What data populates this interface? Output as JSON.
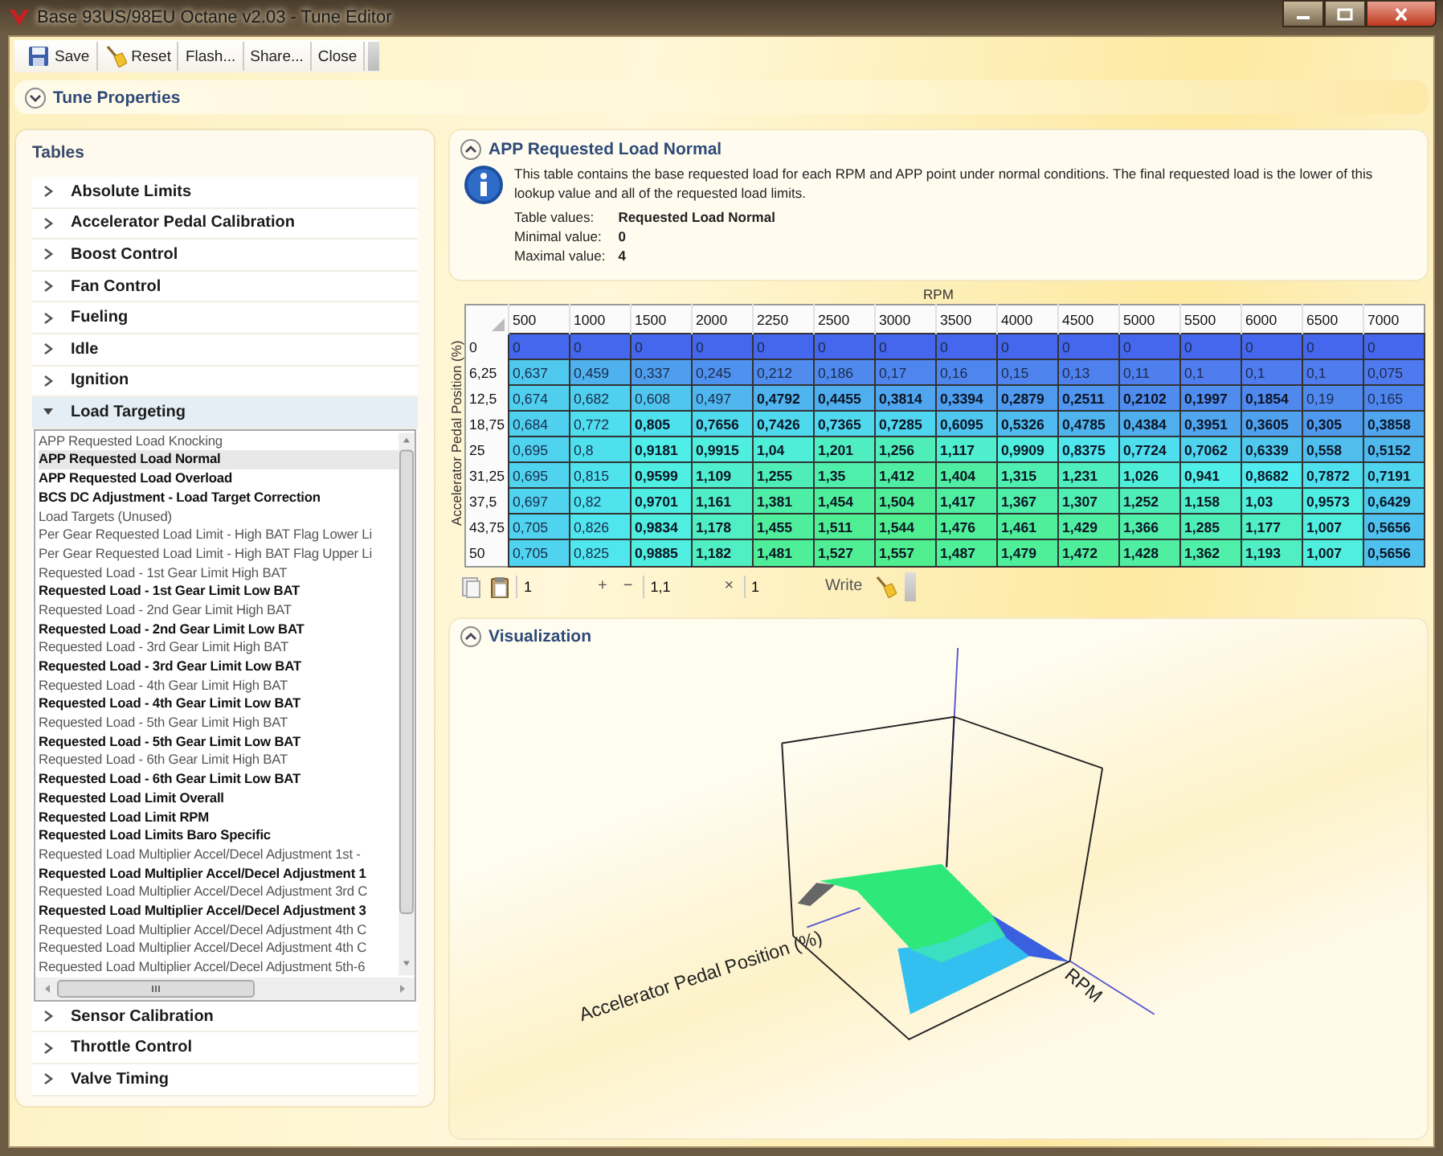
{
  "window": {
    "title": "Base 93US/98EU Octane v2.03 - Tune Editor"
  },
  "toolbar": [
    {
      "label": "Save"
    },
    {
      "label": "Reset"
    },
    {
      "label": "Flash..."
    },
    {
      "label": "Share..."
    },
    {
      "label": "Close"
    }
  ],
  "tune_properties": {
    "title": "Tune Properties",
    "expanded": false
  },
  "tables_panel": {
    "title": "Tables",
    "groups": [
      {
        "label": "Absolute Limits",
        "expanded": false
      },
      {
        "label": "Accelerator Pedal Calibration",
        "expanded": false
      },
      {
        "label": "Boost Control",
        "expanded": false
      },
      {
        "label": "Fan Control",
        "expanded": false
      },
      {
        "label": "Fueling",
        "expanded": false
      },
      {
        "label": "Idle",
        "expanded": false
      },
      {
        "label": "Ignition",
        "expanded": false
      },
      {
        "label": "Load Targeting",
        "expanded": true,
        "children": [
          {
            "label": "APP Requested Load Knocking",
            "bold": false,
            "selected": false
          },
          {
            "label": "APP Requested Load Normal",
            "bold": true,
            "selected": true
          },
          {
            "label": "APP Requested Load Overload",
            "bold": true,
            "selected": false
          },
          {
            "label": "BCS DC Adjustment - Load Target Correction",
            "bold": true,
            "selected": false
          },
          {
            "label": "Load Targets (Unused)",
            "bold": false,
            "selected": false
          },
          {
            "label": "Per Gear Requested Load Limit - High BAT Flag Lower Li",
            "bold": false,
            "selected": false
          },
          {
            "label": "Per Gear Requested Load Limit - High BAT Flag Upper Li",
            "bold": false,
            "selected": false
          },
          {
            "label": "Requested Load - 1st Gear Limit High BAT",
            "bold": false,
            "selected": false
          },
          {
            "label": "Requested Load - 1st Gear Limit Low BAT",
            "bold": true,
            "selected": false
          },
          {
            "label": "Requested Load - 2nd Gear Limit High BAT",
            "bold": false,
            "selected": false
          },
          {
            "label": "Requested Load - 2nd Gear Limit Low BAT",
            "bold": true,
            "selected": false
          },
          {
            "label": "Requested Load - 3rd Gear Limit High BAT",
            "bold": false,
            "selected": false
          },
          {
            "label": "Requested Load - 3rd Gear Limit Low BAT",
            "bold": true,
            "selected": false
          },
          {
            "label": "Requested Load - 4th Gear Limit High BAT",
            "bold": false,
            "selected": false
          },
          {
            "label": "Requested Load - 4th Gear Limit Low BAT",
            "bold": true,
            "selected": false
          },
          {
            "label": "Requested Load - 5th Gear Limit High BAT",
            "bold": false,
            "selected": false
          },
          {
            "label": "Requested Load - 5th Gear Limit Low BAT",
            "bold": true,
            "selected": false
          },
          {
            "label": "Requested Load - 6th Gear Limit High BAT",
            "bold": false,
            "selected": false
          },
          {
            "label": "Requested Load - 6th Gear Limit Low BAT",
            "bold": true,
            "selected": false
          },
          {
            "label": "Requested Load Limit Overall",
            "bold": true,
            "selected": false
          },
          {
            "label": "Requested Load Limit RPM",
            "bold": true,
            "selected": false
          },
          {
            "label": "Requested Load Limits Baro Specific",
            "bold": true,
            "selected": false
          },
          {
            "label": "Requested Load Multiplier Accel/Decel Adjustment 1st -",
            "bold": false,
            "selected": false
          },
          {
            "label": "Requested Load Multiplier Accel/Decel Adjustment 1",
            "bold": true,
            "selected": false
          },
          {
            "label": "Requested Load Multiplier Accel/Decel Adjustment 3rd C",
            "bold": false,
            "selected": false
          },
          {
            "label": "Requested Load Multiplier Accel/Decel Adjustment 3",
            "bold": true,
            "selected": false
          },
          {
            "label": "Requested Load Multiplier Accel/Decel Adjustment 4th C",
            "bold": false,
            "selected": false
          },
          {
            "label": "Requested Load Multiplier Accel/Decel Adjustment 4th C",
            "bold": false,
            "selected": false
          },
          {
            "label": "Requested Load Multiplier Accel/Decel Adjustment 5th-6",
            "bold": false,
            "selected": false
          }
        ]
      },
      {
        "label": "Sensor Calibration",
        "expanded": false
      },
      {
        "label": "Throttle Control",
        "expanded": false
      },
      {
        "label": "Valve Timing",
        "expanded": false
      }
    ]
  },
  "detail": {
    "title": "APP Requested Load Normal",
    "expanded": true,
    "description": "This table contains the base requested load for each RPM and APP point under normal conditions. The final requested load is the lower of this lookup value and all of the requested load limits.",
    "properties": [
      {
        "label": "Table values:",
        "value": "Requested Load Normal"
      },
      {
        "label": "Minimal value:",
        "value": "0"
      },
      {
        "label": "Maximal value:",
        "value": "4"
      }
    ]
  },
  "table": {
    "x_axis": "RPM",
    "y_axis": "Accelerator Pedal Position (%)",
    "columns": [
      "500",
      "1000",
      "1500",
      "2000",
      "2250",
      "2500",
      "3000",
      "3500",
      "4000",
      "4500",
      "5000",
      "5500",
      "6000",
      "6500",
      "7000"
    ],
    "rows": [
      {
        "label": "0",
        "cells": [
          {
            "v": "0",
            "modified": false
          },
          {
            "v": "0",
            "modified": false
          },
          {
            "v": "0",
            "modified": false
          },
          {
            "v": "0",
            "modified": false
          },
          {
            "v": "0",
            "modified": false
          },
          {
            "v": "0",
            "modified": false
          },
          {
            "v": "0",
            "modified": false
          },
          {
            "v": "0",
            "modified": false
          },
          {
            "v": "0",
            "modified": false
          },
          {
            "v": "0",
            "modified": false
          },
          {
            "v": "0",
            "modified": false
          },
          {
            "v": "0",
            "modified": false
          },
          {
            "v": "0",
            "modified": false
          },
          {
            "v": "0",
            "modified": false
          },
          {
            "v": "0",
            "modified": false
          }
        ]
      },
      {
        "label": "6,25",
        "cells": [
          {
            "v": "0,637",
            "modified": false
          },
          {
            "v": "0,459",
            "modified": false
          },
          {
            "v": "0,337",
            "modified": false
          },
          {
            "v": "0,245",
            "modified": false
          },
          {
            "v": "0,212",
            "modified": false
          },
          {
            "v": "0,186",
            "modified": false
          },
          {
            "v": "0,17",
            "modified": false
          },
          {
            "v": "0,16",
            "modified": false
          },
          {
            "v": "0,15",
            "modified": false
          },
          {
            "v": "0,13",
            "modified": false
          },
          {
            "v": "0,11",
            "modified": false
          },
          {
            "v": "0,1",
            "modified": false
          },
          {
            "v": "0,1",
            "modified": false
          },
          {
            "v": "0,1",
            "modified": false
          },
          {
            "v": "0,075",
            "modified": false
          }
        ]
      },
      {
        "label": "12,5",
        "cells": [
          {
            "v": "0,674",
            "modified": false
          },
          {
            "v": "0,682",
            "modified": false
          },
          {
            "v": "0,608",
            "modified": false
          },
          {
            "v": "0,497",
            "modified": false
          },
          {
            "v": "0,4792",
            "modified": true
          },
          {
            "v": "0,4455",
            "modified": true
          },
          {
            "v": "0,3814",
            "modified": true
          },
          {
            "v": "0,3394",
            "modified": true
          },
          {
            "v": "0,2879",
            "modified": true
          },
          {
            "v": "0,2511",
            "modified": true
          },
          {
            "v": "0,2102",
            "modified": true
          },
          {
            "v": "0,1997",
            "modified": true
          },
          {
            "v": "0,1854",
            "modified": true
          },
          {
            "v": "0,19",
            "modified": false
          },
          {
            "v": "0,165",
            "modified": false
          }
        ]
      },
      {
        "label": "18,75",
        "cells": [
          {
            "v": "0,684",
            "modified": false
          },
          {
            "v": "0,772",
            "modified": false
          },
          {
            "v": "0,805",
            "modified": true
          },
          {
            "v": "0,7656",
            "modified": true
          },
          {
            "v": "0,7426",
            "modified": true
          },
          {
            "v": "0,7365",
            "modified": true
          },
          {
            "v": "0,7285",
            "modified": true
          },
          {
            "v": "0,6095",
            "modified": true
          },
          {
            "v": "0,5326",
            "modified": true
          },
          {
            "v": "0,4785",
            "modified": true
          },
          {
            "v": "0,4384",
            "modified": true
          },
          {
            "v": "0,3951",
            "modified": true
          },
          {
            "v": "0,3605",
            "modified": true
          },
          {
            "v": "0,305",
            "modified": true
          },
          {
            "v": "0,3858",
            "modified": true
          }
        ]
      },
      {
        "label": "25",
        "cells": [
          {
            "v": "0,695",
            "modified": false
          },
          {
            "v": "0,8",
            "modified": false
          },
          {
            "v": "0,9181",
            "modified": true
          },
          {
            "v": "0,9915",
            "modified": true
          },
          {
            "v": "1,04",
            "modified": true
          },
          {
            "v": "1,201",
            "modified": true
          },
          {
            "v": "1,256",
            "modified": true
          },
          {
            "v": "1,117",
            "modified": true
          },
          {
            "v": "0,9909",
            "modified": true
          },
          {
            "v": "0,8375",
            "modified": true
          },
          {
            "v": "0,7724",
            "modified": true
          },
          {
            "v": "0,7062",
            "modified": true
          },
          {
            "v": "0,6339",
            "modified": true
          },
          {
            "v": "0,558",
            "modified": true
          },
          {
            "v": "0,5152",
            "modified": true
          }
        ]
      },
      {
        "label": "31,25",
        "cells": [
          {
            "v": "0,695",
            "modified": false
          },
          {
            "v": "0,815",
            "modified": false
          },
          {
            "v": "0,9599",
            "modified": true
          },
          {
            "v": "1,109",
            "modified": true
          },
          {
            "v": "1,255",
            "modified": true
          },
          {
            "v": "1,35",
            "modified": true
          },
          {
            "v": "1,412",
            "modified": true
          },
          {
            "v": "1,404",
            "modified": true
          },
          {
            "v": "1,315",
            "modified": true
          },
          {
            "v": "1,231",
            "modified": true
          },
          {
            "v": "1,026",
            "modified": true
          },
          {
            "v": "0,941",
            "modified": true
          },
          {
            "v": "0,8682",
            "modified": true
          },
          {
            "v": "0,7872",
            "modified": true
          },
          {
            "v": "0,7191",
            "modified": true
          }
        ]
      },
      {
        "label": "37,5",
        "cells": [
          {
            "v": "0,697",
            "modified": false
          },
          {
            "v": "0,82",
            "modified": false
          },
          {
            "v": "0,9701",
            "modified": true
          },
          {
            "v": "1,161",
            "modified": true
          },
          {
            "v": "1,381",
            "modified": true
          },
          {
            "v": "1,454",
            "modified": true
          },
          {
            "v": "1,504",
            "modified": true
          },
          {
            "v": "1,417",
            "modified": true
          },
          {
            "v": "1,367",
            "modified": true
          },
          {
            "v": "1,307",
            "modified": true
          },
          {
            "v": "1,252",
            "modified": true
          },
          {
            "v": "1,158",
            "modified": true
          },
          {
            "v": "1,03",
            "modified": true
          },
          {
            "v": "0,9573",
            "modified": true
          },
          {
            "v": "0,6429",
            "modified": true
          }
        ]
      },
      {
        "label": "43,75",
        "cells": [
          {
            "v": "0,705",
            "modified": false
          },
          {
            "v": "0,826",
            "modified": false
          },
          {
            "v": "0,9834",
            "modified": true
          },
          {
            "v": "1,178",
            "modified": true
          },
          {
            "v": "1,455",
            "modified": true
          },
          {
            "v": "1,511",
            "modified": true
          },
          {
            "v": "1,544",
            "modified": true
          },
          {
            "v": "1,476",
            "modified": true
          },
          {
            "v": "1,461",
            "modified": true
          },
          {
            "v": "1,429",
            "modified": true
          },
          {
            "v": "1,366",
            "modified": true
          },
          {
            "v": "1,285",
            "modified": true
          },
          {
            "v": "1,177",
            "modified": true
          },
          {
            "v": "1,007",
            "modified": true
          },
          {
            "v": "0,5656",
            "modified": true
          }
        ]
      },
      {
        "label": "50",
        "cells": [
          {
            "v": "0,705",
            "modified": false
          },
          {
            "v": "0,825",
            "modified": false
          },
          {
            "v": "0,9885",
            "modified": true
          },
          {
            "v": "1,182",
            "modified": true
          },
          {
            "v": "1,481",
            "modified": true
          },
          {
            "v": "1,527",
            "modified": true
          },
          {
            "v": "1,557",
            "modified": true
          },
          {
            "v": "1,487",
            "modified": true
          },
          {
            "v": "1,479",
            "modified": true
          },
          {
            "v": "1,472",
            "modified": true
          },
          {
            "v": "1,428",
            "modified": true
          },
          {
            "v": "1,362",
            "modified": true
          },
          {
            "v": "1,193",
            "modified": true
          },
          {
            "v": "1,007",
            "modified": true
          },
          {
            "v": "0,5656",
            "modified": true
          }
        ]
      }
    ]
  },
  "table_toolbar": [
    {
      "kind": "icon"
    },
    {
      "kind": "icon"
    },
    {
      "kind": "field",
      "value": "1"
    },
    {
      "kind": "button",
      "label": "+"
    },
    {
      "kind": "button",
      "label": "−"
    },
    {
      "kind": "field",
      "value": "1,1"
    },
    {
      "kind": "button",
      "label": "×"
    },
    {
      "kind": "field",
      "value": "1"
    },
    {
      "kind": "button",
      "label": "Write"
    },
    {
      "kind": "icon"
    }
  ],
  "visualization": {
    "title": "Visualization",
    "expanded": true,
    "x_label": "RPM",
    "y_label": "Accelerator Pedal Position (%)"
  }
}
